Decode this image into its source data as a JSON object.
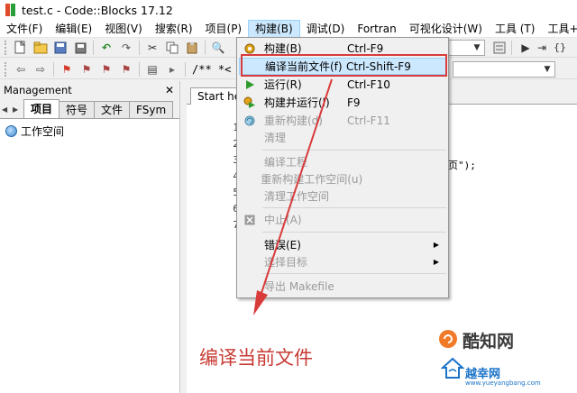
{
  "window": {
    "title": "test.c - Code::Blocks 17.12"
  },
  "menubar": {
    "items": [
      "文件(F)",
      "编辑(E)",
      "视图(V)",
      "搜索(R)",
      "项目(P)",
      "构建(B)",
      "调试(D)",
      "Fortran",
      "可视化设计(W)",
      "工具 (T)",
      "工具+(S)"
    ]
  },
  "toolbar2": {
    "text": "/** *<"
  },
  "management": {
    "title": "Management",
    "tabs": [
      "项目",
      "符号",
      "文件",
      "FSym"
    ],
    "tree_root": "工作空间"
  },
  "editor": {
    "tab_label": "Start here",
    "line_numbers": [
      "1",
      "2",
      "3",
      "4",
      "5",
      "6",
      "7"
    ],
    "code_fragment": "页\");"
  },
  "build_menu": {
    "items": [
      {
        "label": "构建(B)",
        "shortcut": "Ctrl-F9",
        "icon": "gear-icon",
        "disabled": false,
        "highlighted": false
      },
      {
        "label": "编译当前文件(f)",
        "shortcut": "Ctrl-Shift-F9",
        "icon": "",
        "disabled": false,
        "highlighted": true
      },
      {
        "label": "运行(R)",
        "shortcut": "Ctrl-F10",
        "icon": "run-icon",
        "disabled": false,
        "highlighted": false
      },
      {
        "label": "构建并运行(l)",
        "shortcut": "F9",
        "icon": "build-run-icon",
        "disabled": false,
        "highlighted": false
      },
      {
        "label": "重新构建(d)",
        "shortcut": "Ctrl-F11",
        "icon": "rebuild-icon",
        "disabled": true,
        "highlighted": false
      },
      {
        "label": "清理",
        "shortcut": "",
        "icon": "",
        "disabled": true,
        "highlighted": false
      },
      {
        "label": "编译工程",
        "shortcut": "",
        "icon": "",
        "disabled": true,
        "highlighted": false
      },
      {
        "label": "重新构建工作空间(u)",
        "shortcut": "",
        "icon": "",
        "disabled": true,
        "highlighted": false
      },
      {
        "label": "清理工作空间",
        "shortcut": "",
        "icon": "",
        "disabled": true,
        "highlighted": false
      },
      {
        "label": "中止(A)",
        "shortcut": "",
        "icon": "abort-icon",
        "disabled": true,
        "highlighted": false
      },
      {
        "label": "错误(E)",
        "shortcut": "",
        "icon": "",
        "disabled": false,
        "highlighted": false,
        "submenu": true
      },
      {
        "label": "选择目标",
        "shortcut": "",
        "icon": "",
        "disabled": true,
        "highlighted": false,
        "submenu": true
      },
      {
        "label": "导出 Makefile",
        "shortcut": "",
        "icon": "",
        "disabled": true,
        "highlighted": false
      }
    ]
  },
  "annotation": {
    "caption": "编译当前文件",
    "color": "#d93b3b"
  },
  "watermark": {
    "brand": "酷知网",
    "site": "越幸网",
    "url": "www.yueyangbang.com"
  }
}
